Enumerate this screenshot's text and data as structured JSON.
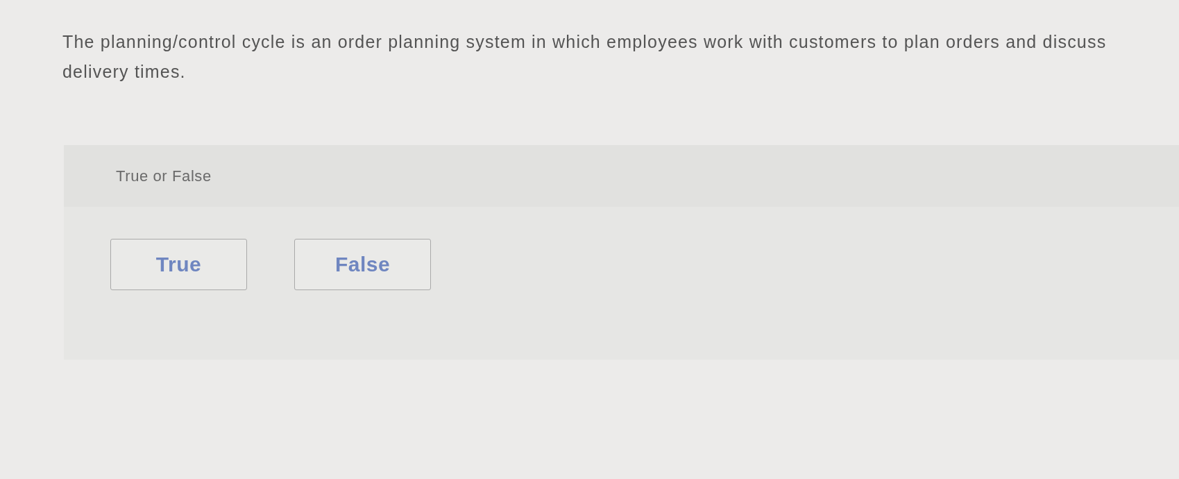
{
  "question": {
    "text": "The planning/control cycle is an order planning system in which employees work with customers to plan orders and discuss delivery times."
  },
  "answer_panel": {
    "prompt": "True or False",
    "options": [
      {
        "label": "True",
        "selected": false
      },
      {
        "label": "False",
        "selected": false
      }
    ]
  }
}
